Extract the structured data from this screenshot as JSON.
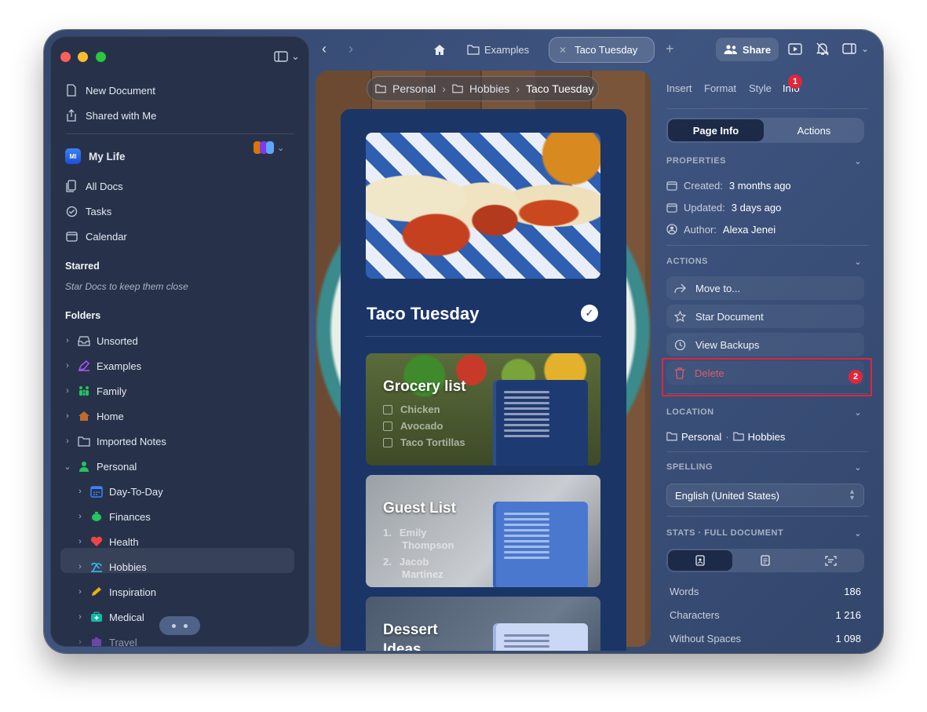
{
  "sidebar": {
    "new_document": "New Document",
    "shared_with_me": "Shared with Me",
    "workspace": {
      "badge": "MI",
      "name": "My Life"
    },
    "nav": [
      {
        "label": "All Docs",
        "icon": "docs-icon"
      },
      {
        "label": "Tasks",
        "icon": "check-circle-icon"
      },
      {
        "label": "Calendar",
        "icon": "calendar-icon"
      }
    ],
    "starred_title": "Starred",
    "starred_hint": "Star Docs to keep them close",
    "folders_title": "Folders",
    "folders": [
      {
        "label": "Unsorted",
        "icon": "inbox-icon",
        "color": "#c9cfdc"
      },
      {
        "label": "Examples",
        "icon": "pen-icon",
        "color": "#a855f7"
      },
      {
        "label": "Family",
        "icon": "family-icon",
        "color": "#22c55e"
      },
      {
        "label": "Home",
        "icon": "house-icon",
        "color": "#c2692a"
      },
      {
        "label": "Imported Notes",
        "icon": "folder-icon",
        "color": "#c9cfdc"
      },
      {
        "label": "Personal",
        "icon": "person-icon",
        "color": "#22c55e"
      }
    ],
    "subfolders": [
      {
        "label": "Day-To-Day",
        "icon": "calendar-grid-icon",
        "color": "#3b82f6"
      },
      {
        "label": "Finances",
        "icon": "piggy-bank-icon",
        "color": "#22c55e"
      },
      {
        "label": "Health",
        "icon": "heart-icon",
        "color": "#ef4444"
      },
      {
        "label": "Hobbies",
        "icon": "beach-icon",
        "color": "#38bdf8"
      },
      {
        "label": "Inspiration",
        "icon": "pencil-icon",
        "color": "#eab308"
      },
      {
        "label": "Medical",
        "icon": "medkit-icon",
        "color": "#14b8a6"
      },
      {
        "label": "Travel",
        "icon": "luggage-icon",
        "color": "#a855f7"
      }
    ]
  },
  "toolbar": {
    "tab_examples": "Examples",
    "tab_active": "Taco Tuesday",
    "share": "Share"
  },
  "document": {
    "breadcrumb": [
      "Personal",
      "Hobbies",
      "Taco Tuesday"
    ],
    "title": "Taco Tuesday",
    "tiles": [
      {
        "title": "Grocery list",
        "items": [
          "Chicken",
          "Avocado",
          "Taco Tortillas"
        ]
      },
      {
        "title": "Guest List",
        "items": [
          "1.",
          "Emily",
          "Thompson",
          "2.",
          "Jacob",
          "Martinez"
        ]
      },
      {
        "title": "Dessert",
        "items": [
          "Ideas"
        ]
      }
    ]
  },
  "inspector": {
    "tabs": [
      "Insert",
      "Format",
      "Style",
      "Info"
    ],
    "annotation_1": "1",
    "annotation_2": "2",
    "segment": {
      "on": "Page Info",
      "off": "Actions"
    },
    "properties_title": "PROPERTIES",
    "created_label": "Created:",
    "created_value": "3 months ago",
    "updated_label": "Updated:",
    "updated_value": "3 days ago",
    "author_label": "Author:",
    "author_value": "Alexa Jenei",
    "actions_title": "ACTIONS",
    "actions": [
      "Move to...",
      "Star Document",
      "View Backups",
      "Delete"
    ],
    "location_title": "LOCATION",
    "location": [
      "Personal",
      "Hobbies"
    ],
    "location_sep": "·",
    "spelling_title": "SPELLING",
    "spelling_value": "English (United States)",
    "stats_title": "STATS · FULL DOCUMENT",
    "stats": [
      {
        "label": "Words",
        "value": "186"
      },
      {
        "label": "Characters",
        "value": "1 216"
      },
      {
        "label": "Without Spaces",
        "value": "1 098"
      }
    ]
  },
  "colors": {
    "accent_red": "#e0263a",
    "card_blue": "#1b3567"
  }
}
